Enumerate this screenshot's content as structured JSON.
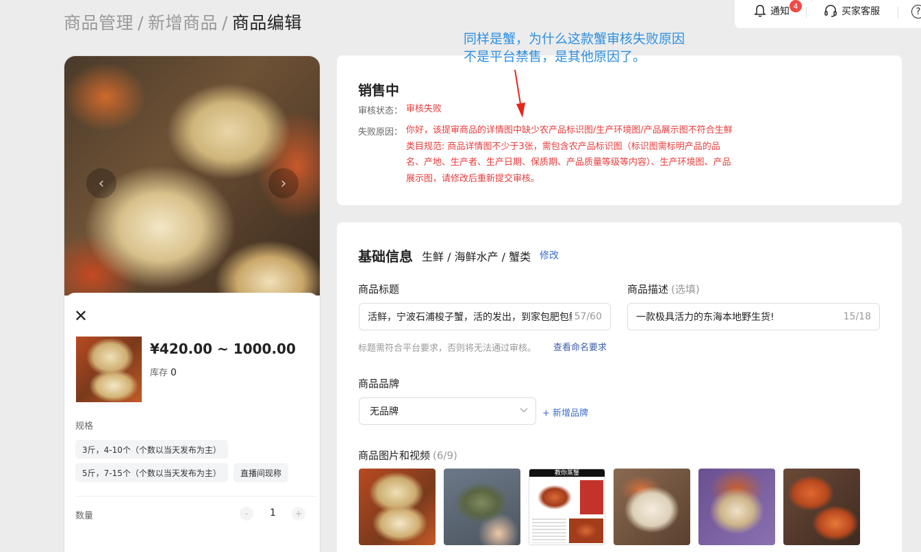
{
  "breadcrumb": {
    "level1": "商品管理",
    "sep": "/",
    "level2": "新增商品",
    "current": "商品编辑"
  },
  "topbar": {
    "notify_label": "通知",
    "notify_count": "4",
    "service_label": "买家客服",
    "help_glyph": "?"
  },
  "preview": {
    "price": "¥420.00 ~ 1000.00",
    "stock_label": "库存",
    "stock_value": "0",
    "spec_title": "规格",
    "specs": [
      "3斤，4-10个（个数以当天发布为主）",
      "5斤，7-15个（个数以当天发布为主）",
      "直播间现称"
    ],
    "qty_label": "数量",
    "qty_minus": "-",
    "qty_value": "1",
    "qty_plus": "+",
    "close_glyph": "✕",
    "prev_glyph": "‹",
    "next_glyph": "›"
  },
  "status": {
    "title": "销售中",
    "audit_label": "审核状态：",
    "audit_value": "审核失败",
    "reason_label": "失败原因：",
    "reason_value": "你好，该提审商品的详情图中缺少农产品标识图/生产环境图/产品展示图不符合生鲜类目规范: 商品详情图不少于3张，需包含农产品标识图（标识图需标明产品的品名、产地、生产者、生产日期、保质期、产品质量等级等内容）、生产环境图、产品展示图，请修改后重新提交审核。"
  },
  "annotation": {
    "text": "同样是蟹，为什么这款蟹审核失败原因\n不是平台禁售，是其他原因了。"
  },
  "basic": {
    "title": "基础信息",
    "category": "生鲜 / 海鲜水产 / 蟹类",
    "edit_label": "修改",
    "product_title_label": "商品标题",
    "product_title_value": "活鲜，宁波石浦梭子蟹，活的发出，到家包肥包鲜",
    "product_title_count": "57/60",
    "desc_label": "商品描述",
    "desc_optional": "(选填)",
    "desc_value": "一款极具活力的东海本地野生货!",
    "desc_count": "15/18",
    "title_hint": "标题需符合平台要求，否则将无法通过审核。",
    "title_hint_link": "查看命名要求",
    "brand_label": "商品品牌",
    "brand_value": "无品牌",
    "add_brand": "+ 新增品牌",
    "images_label": "商品图片和视频",
    "images_count": "(6/9)",
    "gallery_poster_text": "教你蒸蟹"
  },
  "colors": {
    "error": "#e83b3b",
    "link": "#3d6bd0",
    "annotation": "#2e8fe0",
    "badge": "#f04a44"
  }
}
